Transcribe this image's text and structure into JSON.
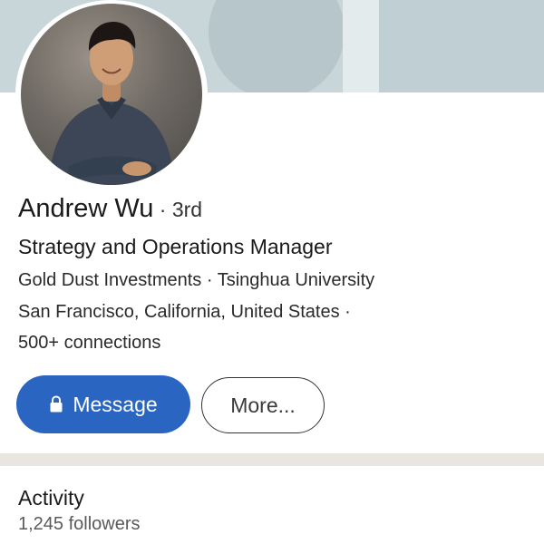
{
  "profile": {
    "name": "Andrew Wu",
    "degree": " · 3rd",
    "headline": "Strategy and Operations Manager",
    "company_line": "Gold Dust Investments · Tsinghua University",
    "location_line": "San Francisco, California, United States ·",
    "connections": "500+ connections"
  },
  "actions": {
    "message_label": "Message",
    "more_label": "More..."
  },
  "activity": {
    "title": "Activity",
    "followers": "1,245 followers"
  },
  "icons": {
    "message_icon": "lock-icon"
  },
  "colors": {
    "accent": "#2a65c1",
    "cover": "#c9d6d9"
  }
}
